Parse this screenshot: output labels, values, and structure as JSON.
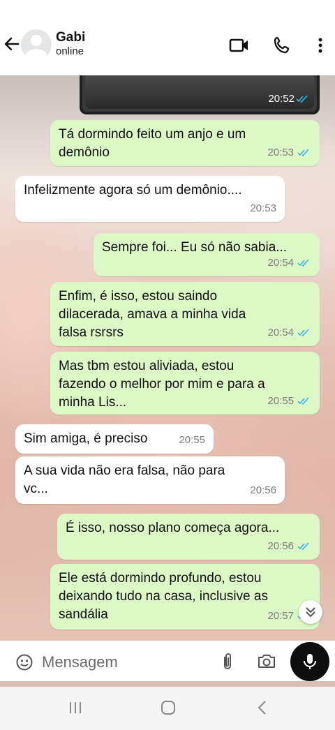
{
  "header": {
    "contact_name": "Gabi",
    "status": "online",
    "icons": [
      "back-arrow-icon",
      "avatar",
      "video-call-icon",
      "phone-icon",
      "more-vertical-icon"
    ]
  },
  "messages": [
    {
      "type": "photo",
      "direction": "out",
      "time": "20:52",
      "read": true
    },
    {
      "direction": "out",
      "text": "Tá dormindo feito um anjo e um\ndemônio",
      "time": "20:53",
      "read": true
    },
    {
      "direction": "in",
      "text": "Infelizmente agora só um demônio....",
      "time": "20:53"
    },
    {
      "direction": "out",
      "text": "Sempre foi... Eu só não sabia...",
      "time": "20:54",
      "read": true
    },
    {
      "direction": "out",
      "text": "Enfim, é isso, estou saindo\ndilacerada, amava a minha vida\nfalsa rsrsrs",
      "time": "20:54",
      "read": true
    },
    {
      "direction": "out",
      "text": "Mas tbm estou aliviada, estou\nfazendo o melhor por mim e para a\nminha Lis...",
      "time": "20:55",
      "read": true
    },
    {
      "direction": "in",
      "text": "Sim amiga, é preciso",
      "time": "20:55"
    },
    {
      "direction": "in",
      "text": "A sua vida não era falsa, não para\nvc...",
      "time": "20:56"
    },
    {
      "direction": "out",
      "text": "É isso, nosso plano começa agora...",
      "time": "20:56",
      "read": true
    },
    {
      "direction": "out",
      "text": "Ele está dormindo profundo, estou\ndeixando tudo na casa, inclusive as\nsandália",
      "time": "20:57",
      "read": true
    }
  ],
  "composer": {
    "placeholder": "Mensagem",
    "icons": [
      "emoji-icon",
      "attach-icon",
      "camera-icon",
      "mic-icon"
    ]
  },
  "colors": {
    "outgoing_bubble": "#dcf8c6",
    "incoming_bubble": "#ffffff",
    "read_check": "#34b7f1"
  }
}
